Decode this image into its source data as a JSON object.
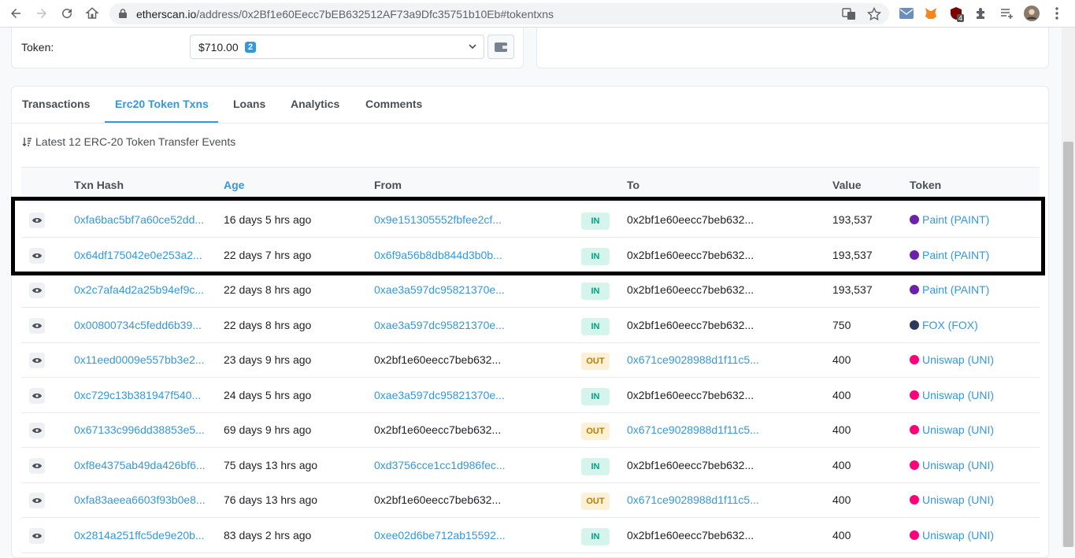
{
  "browser": {
    "url_domain": "etherscan.io",
    "url_path": "/address/0x2Bf1e60Eecc7bEB632512AF73a9Dfc35751b10Eb#tokentxns",
    "extension_badge": "4"
  },
  "token_card": {
    "label": "Token:",
    "value": "$710.00",
    "count": "2"
  },
  "tabs": [
    {
      "label": "Transactions"
    },
    {
      "label": "Erc20 Token Txns"
    },
    {
      "label": "Loans"
    },
    {
      "label": "Analytics"
    },
    {
      "label": "Comments"
    }
  ],
  "summary": "Latest 12 ERC-20 Token Transfer Events",
  "columns": {
    "hash": "Txn Hash",
    "age": "Age",
    "from": "From",
    "to": "To",
    "value": "Value",
    "token": "Token"
  },
  "rows": [
    {
      "hash": "0xfa6bac5bf7a60ce52dd...",
      "age": "16 days 5 hrs ago",
      "from": "0x9e151305552fbfee2cf...",
      "dir": "IN",
      "to": "0x2bf1e60eecc7beb632...",
      "value": "193,537",
      "token": "Paint (PAINT)"
    },
    {
      "hash": "0x64df175042e0e253a2...",
      "age": "22 days 7 hrs ago",
      "from": "0x6f9a56b8db844d3b0b...",
      "dir": "IN",
      "to": "0x2bf1e60eecc7beb632...",
      "value": "193,537",
      "token": "Paint (PAINT)"
    },
    {
      "hash": "0x2c7afa4d2a25b94ef9c...",
      "age": "22 days 8 hrs ago",
      "from": "0xae3a597dc95821370e...",
      "dir": "IN",
      "to": "0x2bf1e60eecc7beb632...",
      "value": "193,537",
      "token": "Paint (PAINT)"
    },
    {
      "hash": "0x00800734c5fedd6b39...",
      "age": "22 days 8 hrs ago",
      "from": "0xae3a597dc95821370e...",
      "dir": "IN",
      "to": "0x2bf1e60eecc7beb632...",
      "value": "750",
      "token": "FOX (FOX)"
    },
    {
      "hash": "0x11eed0009e557bb3e2...",
      "age": "23 days 9 hrs ago",
      "from": "0x2bf1e60eecc7beb632...",
      "dir": "OUT",
      "to": "0x671ce9028988d1f11c5...",
      "value": "400",
      "token": "Uniswap (UNI)"
    },
    {
      "hash": "0xc729c13b381947f540...",
      "age": "24 days 5 hrs ago",
      "from": "0xae3a597dc95821370e...",
      "dir": "IN",
      "to": "0x2bf1e60eecc7beb632...",
      "value": "400",
      "token": "Uniswap (UNI)"
    },
    {
      "hash": "0x67133c996dd38853e5...",
      "age": "69 days 9 hrs ago",
      "from": "0x2bf1e60eecc7beb632...",
      "dir": "OUT",
      "to": "0x671ce9028988d1f11c5...",
      "value": "400",
      "token": "Uniswap (UNI)"
    },
    {
      "hash": "0xf8e4375ab49da426bf6...",
      "age": "75 days 13 hrs ago",
      "from": "0xd3756cce1cc1d986fec...",
      "dir": "IN",
      "to": "0x2bf1e60eecc7beb632...",
      "value": "400",
      "token": "Uniswap (UNI)"
    },
    {
      "hash": "0xfa83aeea6603f93b0e8...",
      "age": "76 days 13 hrs ago",
      "from": "0x2bf1e60eecc7beb632...",
      "dir": "OUT",
      "to": "0x671ce9028988d1f11c5...",
      "value": "400",
      "token": "Uniswap (UNI)"
    },
    {
      "hash": "0x2814a251ffc5de9e20b...",
      "age": "83 days 2 hrs ago",
      "from": "0xee02d6be712ab15592...",
      "dir": "IN",
      "to": "0x2bf1e60eecc7beb632...",
      "value": "400",
      "token": "Uniswap (UNI)"
    }
  ],
  "token_icons": {
    "Paint (PAINT)": "#6b21a8",
    "FOX (FOX)": "#2d3a5a",
    "Uniswap (UNI)": "#ff007a"
  }
}
